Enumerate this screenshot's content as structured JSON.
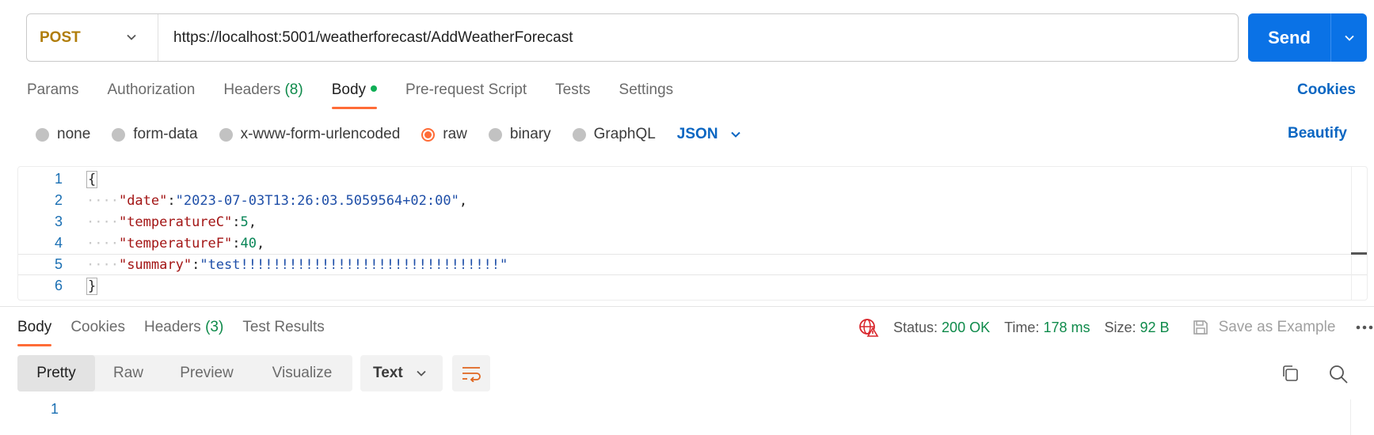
{
  "request": {
    "method": "POST",
    "url": "https://localhost:5001/weatherforecast/AddWeatherForecast",
    "send_label": "Send"
  },
  "tabs": [
    {
      "label": "Params"
    },
    {
      "label": "Authorization"
    },
    {
      "label": "Headers",
      "count": "(8)"
    },
    {
      "label": "Body",
      "active": true
    },
    {
      "label": "Pre-request Script"
    },
    {
      "label": "Tests"
    },
    {
      "label": "Settings"
    }
  ],
  "cookies_label": "Cookies",
  "body_types": [
    "none",
    "form-data",
    "x-www-form-urlencoded",
    "raw",
    "binary",
    "GraphQL"
  ],
  "body_type_selected": "raw",
  "language": "JSON",
  "beautify_label": "Beautify",
  "editor": {
    "line_numbers": [
      "1",
      "2",
      "3",
      "4",
      "5",
      "6"
    ],
    "lines": {
      "l1": "{",
      "l2_key": "\"date\"",
      "l2_val": "\"2023-07-03T13:26:03.5059564+02:00\"",
      "l3_key": "\"temperatureC\"",
      "l3_val": "5",
      "l4_key": "\"temperatureF\"",
      "l4_val": "40",
      "l5_key": "\"summary\"",
      "l5_val": "\"test!!!!!!!!!!!!!!!!!!!!!!!!!!!!!!!!\"",
      "l6": "}"
    },
    "indent": "····",
    "colon": ":",
    "comma": ","
  },
  "response": {
    "tabs": [
      {
        "label": "Body",
        "active": true
      },
      {
        "label": "Cookies"
      },
      {
        "label": "Headers",
        "count": "(3)"
      },
      {
        "label": "Test Results"
      }
    ],
    "status_label": "Status:",
    "status_value": "200 OK",
    "time_label": "Time:",
    "time_value": "178 ms",
    "size_label": "Size:",
    "size_value": "92 B",
    "save_example_label": "Save as Example",
    "views": [
      "Pretty",
      "Raw",
      "Preview",
      "Visualize"
    ],
    "view_selected": "Pretty",
    "format": "Text",
    "line_number": "1"
  },
  "colors": {
    "accent": "#ff6c37",
    "primary": "#0a72e6",
    "link": "#0a66c2",
    "success": "#0e8a4a"
  }
}
